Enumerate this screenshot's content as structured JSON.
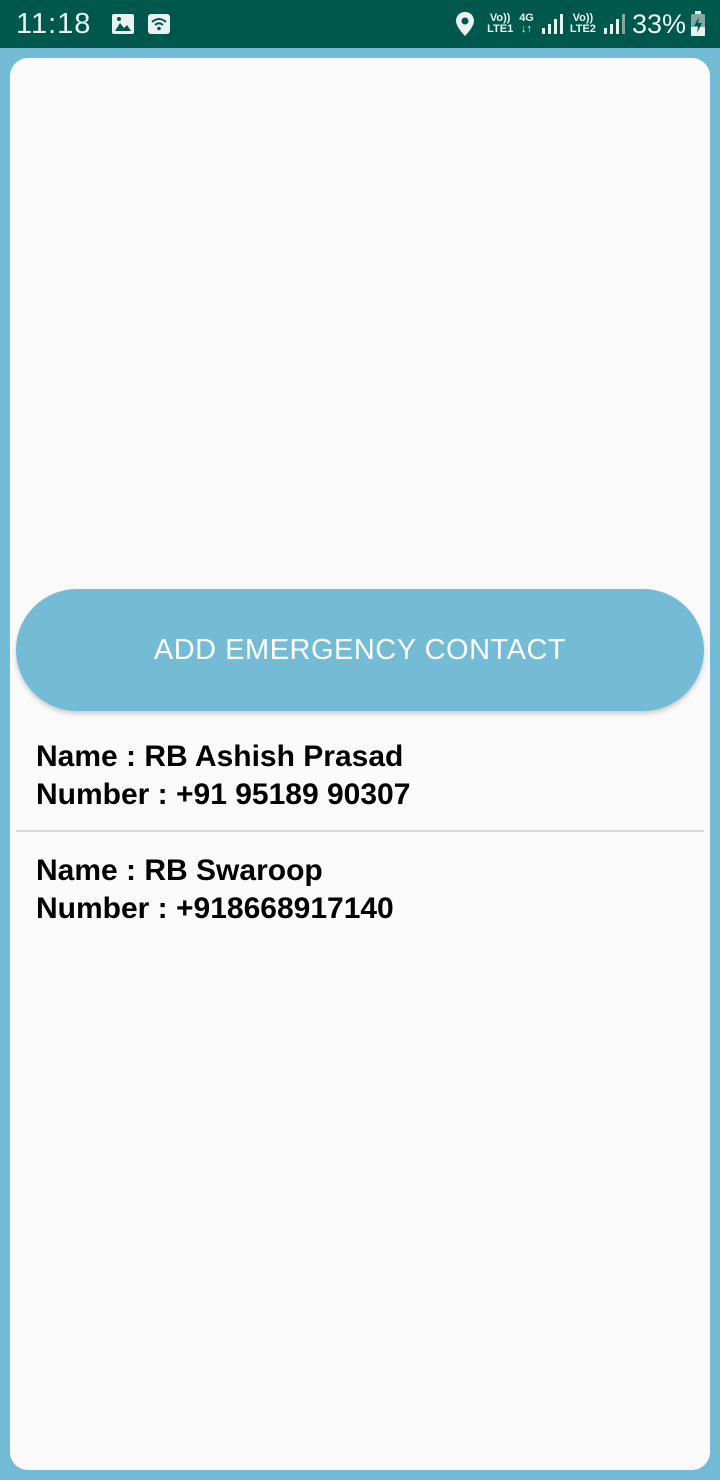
{
  "status_bar": {
    "time": "11:18",
    "sim1_top": "Vo))",
    "sim1_bottom": "LTE1",
    "net_top": "4G",
    "net_bottom": "↓↑",
    "sim2_top": "Vo))",
    "sim2_bottom": "LTE2",
    "battery": "33%",
    "bg_color": "#00574b"
  },
  "main": {
    "add_button_label": "ADD EMERGENCY CONTACT",
    "accent_color": "#74bcd5",
    "contacts": [
      {
        "name_line": "Name : RB Ashish Prasad",
        "number_line": "Number : +91 95189 90307"
      },
      {
        "name_line": "Name : RB Swaroop",
        "number_line": "Number : +918668917140"
      }
    ]
  },
  "icons": [
    "image-icon",
    "wifi-icon",
    "location-icon",
    "signal-icon",
    "battery-charging-icon"
  ]
}
